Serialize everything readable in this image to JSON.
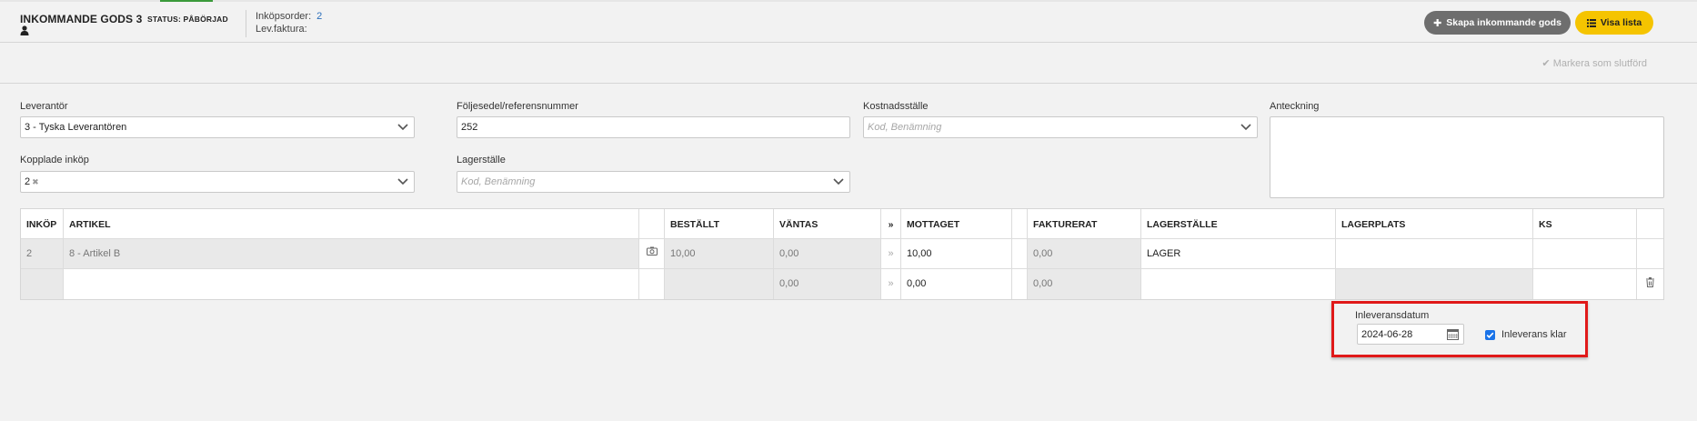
{
  "header": {
    "title": "INKOMMANDE GODS 3",
    "status": "STATUS: PÅBÖRJAD",
    "purchase_order_label": "Inköpsorder:",
    "purchase_order_value": "2",
    "supplier_invoice_label": "Lev.faktura:",
    "create_button": "Skapa inkommande gods",
    "list_button": "Visa lista",
    "mark_done": "Markera som slutförd"
  },
  "form": {
    "supplier": {
      "label": "Leverantör",
      "value": "3 - Tyska Leverantören"
    },
    "reference": {
      "label": "Följesedel/referensnummer",
      "value": "252"
    },
    "cost_center": {
      "label": "Kostnadsställe",
      "placeholder": "Kod, Benämning"
    },
    "note": {
      "label": "Anteckning",
      "value": ""
    },
    "linked_purchases": {
      "label": "Kopplade inköp",
      "tag": "2"
    },
    "warehouse": {
      "label": "Lagerställe",
      "placeholder": "Kod, Benämning"
    }
  },
  "table": {
    "headers": {
      "inkop": "INKÖP",
      "artikel": "ARTIKEL",
      "bestallt": "BESTÄLLT",
      "vantas": "VÄNTAS",
      "arrow": "»",
      "mottaget": "MOTTAGET",
      "fakturerat": "FAKTURERAT",
      "lagerstalle": "LAGERSTÄLLE",
      "lagerplats": "LAGERPLATS",
      "ks": "KS"
    },
    "rows": [
      {
        "inkop": "2",
        "artikel": "8 - Artikel B",
        "bestallt": "10,00",
        "vantas": "0,00",
        "arrow": "»",
        "mottaget": "10,00",
        "fakturerat": "0,00",
        "lagerstalle": "LAGER",
        "lagerplats": "",
        "ks": ""
      },
      {
        "inkop": "",
        "artikel": "",
        "bestallt": "",
        "vantas": "0,00",
        "arrow": "»",
        "mottaget": "0,00",
        "fakturerat": "0,00",
        "lagerstalle": "",
        "lagerplats": "",
        "ks": ""
      }
    ]
  },
  "delivery": {
    "date_label": "Inleveransdatum",
    "date_value": "2024-06-28",
    "done_label": "Inleverans klar",
    "done_checked": true
  },
  "colors": {
    "accent_green": "#3a9a3a",
    "link_blue": "#2a6ebb",
    "button_gray": "#6e6e6e",
    "button_yellow": "#f5c400",
    "highlight_red": "#e01919",
    "checkbox_blue": "#1a73e8"
  },
  "icons": {
    "user": "user-icon",
    "plus": "plus-icon",
    "list": "list-icon",
    "check": "check-icon",
    "chevron": "chevron-down-icon",
    "camera": "camera-icon",
    "trash": "trash-icon",
    "calendar": "calendar-icon"
  }
}
